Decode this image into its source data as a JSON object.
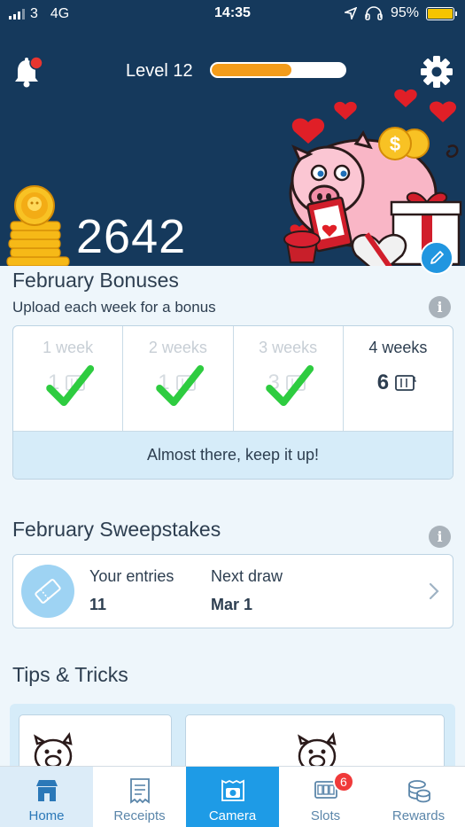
{
  "status_bar": {
    "carrier": "3",
    "network": "4G",
    "time": "14:35",
    "battery": "95%"
  },
  "header": {
    "level_label": "Level 12",
    "level_progress": 0.6,
    "points": "2642"
  },
  "bonuses": {
    "title": "February Bonuses",
    "subtitle": "Upload each week for a bonus",
    "weeks": [
      {
        "label": "1 week",
        "value": "1",
        "done": true
      },
      {
        "label": "2 weeks",
        "value": "1",
        "done": true
      },
      {
        "label": "3 weeks",
        "value": "3",
        "done": true
      },
      {
        "label": "4 weeks",
        "value": "6",
        "done": false
      }
    ],
    "message": "Almost there, keep it up!"
  },
  "sweepstakes": {
    "title": "February Sweepstakes",
    "entries_label": "Your entries",
    "entries_value": "11",
    "draw_label": "Next draw",
    "draw_value": "Mar 1"
  },
  "tips": {
    "title": "Tips & Tricks"
  },
  "tabs": [
    {
      "label": "Home",
      "icon": "home-icon"
    },
    {
      "label": "Receipts",
      "icon": "receipt-icon"
    },
    {
      "label": "Camera",
      "icon": "camera-icon"
    },
    {
      "label": "Slots",
      "icon": "slots-icon",
      "badge": "6"
    },
    {
      "label": "Rewards",
      "icon": "rewards-icon"
    }
  ],
  "colors": {
    "header_bg": "#15395c",
    "accent": "#1e9be6",
    "check": "#2ecc40",
    "badge": "#f03a3a",
    "progress": "#f39c1a"
  }
}
